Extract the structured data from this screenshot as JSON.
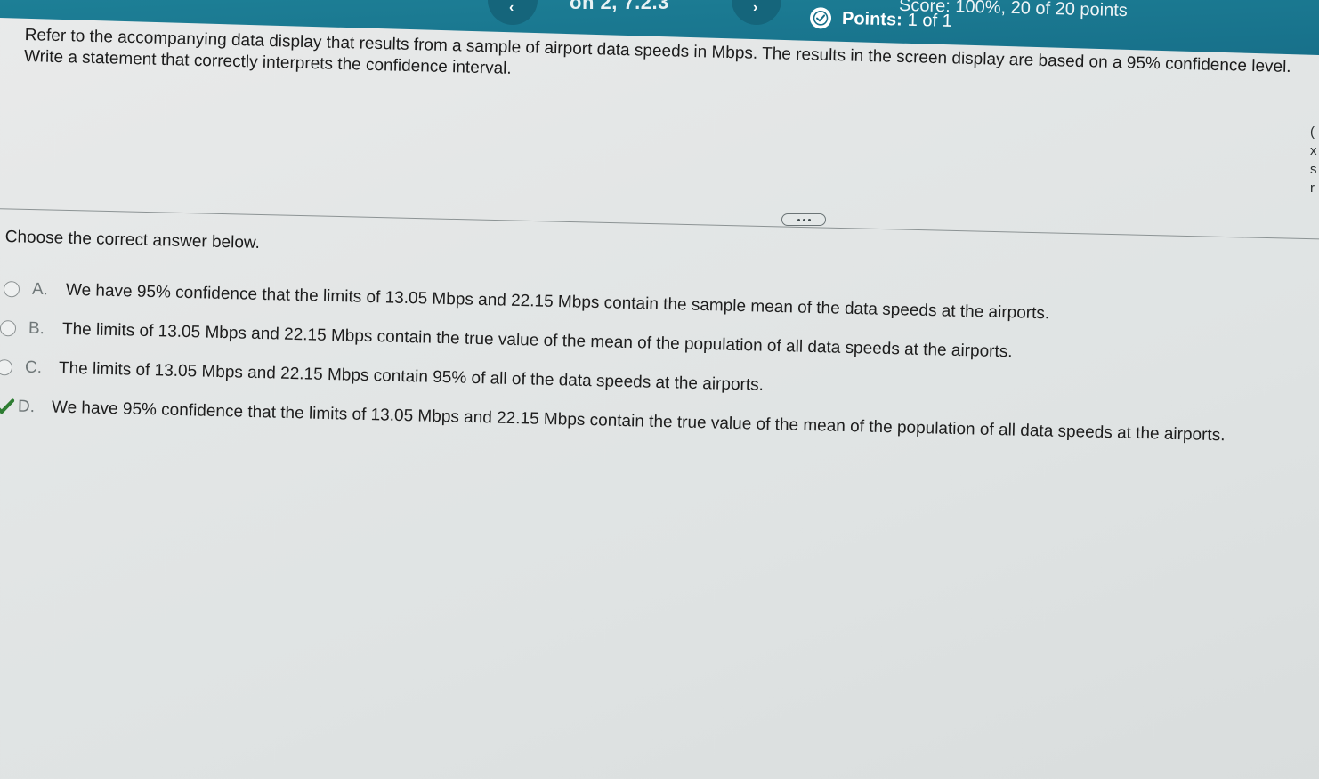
{
  "header": {
    "section": "on 2, 7.2.3",
    "score": "Score: 100%, 20 of 20 points",
    "points_label": "Points:",
    "points_value": "1 of 1",
    "prev_icon": "chevron-left",
    "next_icon": "chevron-right",
    "points_icon": "check-circle",
    "band_color": "#17708a"
  },
  "question": {
    "text": "Refer to the accompanying data display that results from a sample of airport data speeds in Mbps. The results in the screen display are based on a 95% confidence level. Write a statement that correctly interprets the confidence interval."
  },
  "more_button": {
    "icon": "more-dots"
  },
  "instruction": "Choose the correct answer below.",
  "options": [
    {
      "letter": "A.",
      "text": "We have 95% confidence that the limits of 13.05 Mbps and 22.15 Mbps contain the sample mean of the data speeds at the airports.",
      "selected": false
    },
    {
      "letter": "B.",
      "text": "The limits of 13.05 Mbps and 22.15 Mbps contain the true value of the mean of the population of all data speeds at the airports.",
      "selected": false
    },
    {
      "letter": "C.",
      "text": "The limits of 13.05 Mbps and 22.15 Mbps contain 95% of all of the data speeds at the airports.",
      "selected": false
    },
    {
      "letter": "D.",
      "text": "We have 95% confidence that the limits of 13.05 Mbps and 22.15 Mbps contain the true value of the mean of the population of all data speeds at the airports.",
      "selected": true,
      "correct": true,
      "check_color": "#2e7d32"
    }
  ]
}
